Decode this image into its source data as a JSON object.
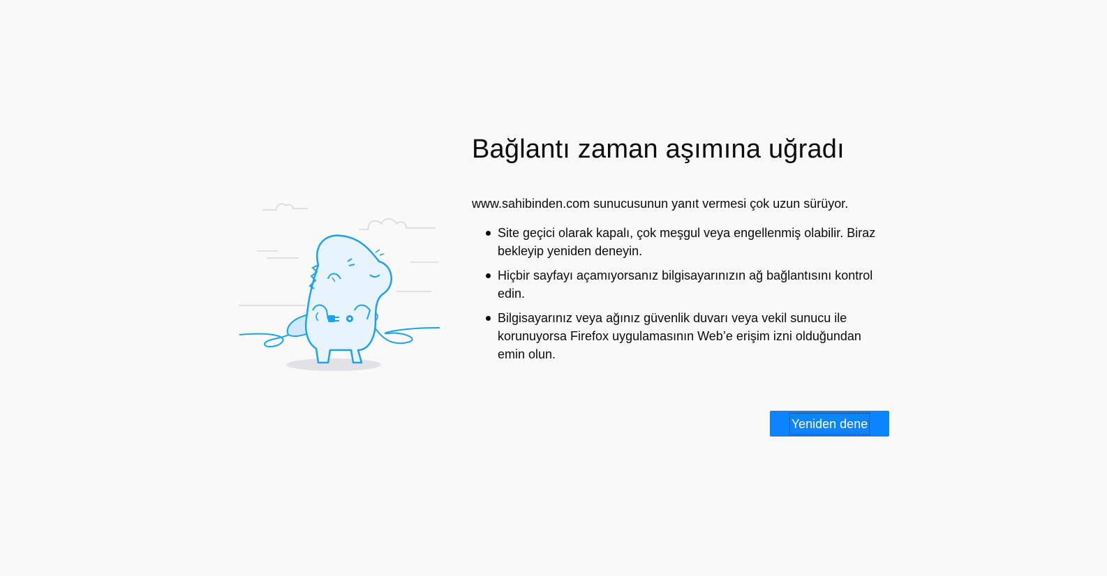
{
  "error": {
    "title": "Bağlantı zaman aşımına uğradı",
    "description": "www.sahibinden.com sunucusunun yanıt vermesi çok uzun sürüyor.",
    "reasons": [
      "Site geçici olarak kapalı, çok meşgul veya engellenmiş olabilir. Biraz bekleyip yeniden deneyin.",
      "Hiçbir sayfayı açamıyorsanız bilgisayarınızın ağ bağlantısını kontrol edin.",
      "Bilgisayarınız veya ağınız güvenlik duvarı veya vekil sunucu ile korunuyorsa Firefox uygulamasının Web’e erişim izni olduğundan emin olun."
    ],
    "retry_label": "Yeniden dene"
  },
  "illustration": {
    "icon": "sad-dinosaur-unplugged-icon"
  },
  "colors": {
    "background": "#f9f9fa",
    "accent": "#0a84ff",
    "illustration_stroke": "#1da1f2",
    "illustration_fill": "#e8f4fd"
  }
}
